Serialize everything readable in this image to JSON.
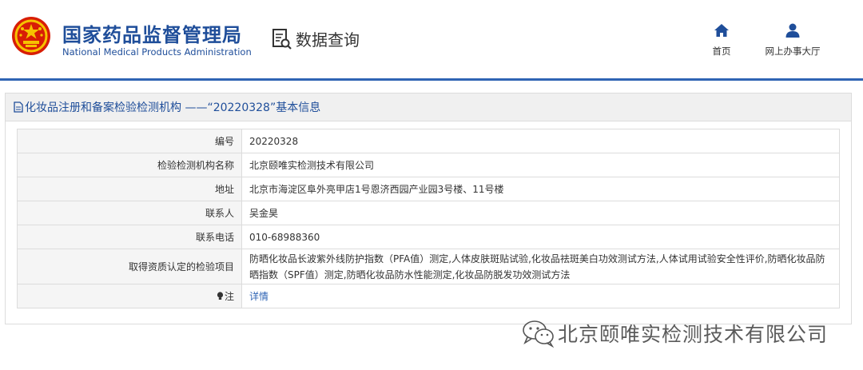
{
  "header": {
    "brand_cn": "国家药品监督管理局",
    "brand_en": "National Medical Products Administration",
    "data_query": "数据查询",
    "nav": {
      "home": "首页",
      "service_hall": "网上办事大厅"
    }
  },
  "panel": {
    "title": "化妆品注册和备案检验检测机构 ——“20220328”基本信息"
  },
  "rows": [
    {
      "label": "编号",
      "value": "20220328"
    },
    {
      "label": "检验检测机构名称",
      "value": "北京颐唯实检测技术有限公司"
    },
    {
      "label": "地址",
      "value": "北京市海淀区阜外亮甲店1号恩济西园产业园3号楼、11号楼"
    },
    {
      "label": "联系人",
      "value": "吴金昊"
    },
    {
      "label": "联系电话",
      "value": "010-68988360"
    },
    {
      "label": "取得资质认定的检验项目",
      "value": "防晒化妆品长波紫外线防护指数（PFA值）测定,人体皮肤斑贴试验,化妆品祛斑美白功效测试方法,人体试用试验安全性评价,防晒化妆品防晒指数（SPF值）测定,防晒化妆品防水性能测定,化妆品防脱发功效测试方法"
    },
    {
      "label": "注",
      "value": "详情"
    }
  ],
  "watermark": {
    "text": "北京颐唯实检测技术有限公司"
  },
  "colors": {
    "brand_blue": "#1f4e9a",
    "link_blue": "#2f64b4",
    "emblem_red": "#d81e06",
    "emblem_gold": "#f6c300"
  }
}
